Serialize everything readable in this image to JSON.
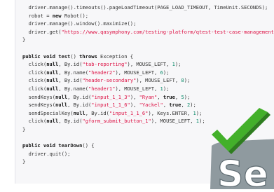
{
  "code_lines": [
    {
      "indent": 1,
      "segments": [
        {
          "t": "driver.manage().timeouts().pageLoadTimeout(PAGE_LOAD_TIMEOUT, TimeUnit.SECONDS);",
          "c": "p"
        }
      ]
    },
    {
      "indent": 1,
      "segments": [
        {
          "t": "robot = ",
          "c": "p"
        },
        {
          "t": "new",
          "c": "kw"
        },
        {
          "t": " Robot();",
          "c": "p"
        }
      ]
    },
    {
      "indent": 1,
      "segments": [
        {
          "t": "driver.manage().window().maximize();",
          "c": "p"
        }
      ]
    },
    {
      "indent": 1,
      "segments": [
        {
          "t": "driver.get(",
          "c": "p"
        },
        {
          "t": "\"https://www.qasymphony.com/testing-platform/qtest-test-case-management\"",
          "c": "str"
        },
        {
          "t": ");",
          "c": "p"
        }
      ]
    },
    {
      "indent": 0,
      "segments": [
        {
          "t": "}",
          "c": "p"
        }
      ]
    },
    {
      "indent": 0,
      "segments": [
        {
          "t": "",
          "c": "p"
        }
      ]
    },
    {
      "indent": 0,
      "segments": [
        {
          "t": "public void ",
          "c": "kw"
        },
        {
          "t": "test",
          "c": "fn"
        },
        {
          "t": "() ",
          "c": "p"
        },
        {
          "t": "throws",
          "c": "kw"
        },
        {
          "t": " Exception {",
          "c": "p"
        }
      ]
    },
    {
      "indent": 1,
      "segments": [
        {
          "t": "click(",
          "c": "p"
        },
        {
          "t": "null",
          "c": "kw"
        },
        {
          "t": ", By.id(",
          "c": "p"
        },
        {
          "t": "\"tab-reporting\"",
          "c": "str"
        },
        {
          "t": "), MOUSE_LEFT, ",
          "c": "p"
        },
        {
          "t": "1",
          "c": "num"
        },
        {
          "t": ");",
          "c": "p"
        }
      ]
    },
    {
      "indent": 1,
      "segments": [
        {
          "t": "click(",
          "c": "p"
        },
        {
          "t": "null",
          "c": "kw"
        },
        {
          "t": ", By.name(",
          "c": "p"
        },
        {
          "t": "\"header2\"",
          "c": "str"
        },
        {
          "t": "), MOUSE_LEFT, ",
          "c": "p"
        },
        {
          "t": "6",
          "c": "num"
        },
        {
          "t": ");",
          "c": "p"
        }
      ]
    },
    {
      "indent": 1,
      "segments": [
        {
          "t": "click(",
          "c": "p"
        },
        {
          "t": "null",
          "c": "kw"
        },
        {
          "t": ", By.id(",
          "c": "p"
        },
        {
          "t": "\"header-secondary\"",
          "c": "str"
        },
        {
          "t": "), MOUSE_LEFT, ",
          "c": "p"
        },
        {
          "t": "8",
          "c": "num"
        },
        {
          "t": ");",
          "c": "p"
        }
      ]
    },
    {
      "indent": 1,
      "segments": [
        {
          "t": "click(",
          "c": "p"
        },
        {
          "t": "null",
          "c": "kw"
        },
        {
          "t": ", By.name(",
          "c": "p"
        },
        {
          "t": "\"header1\"",
          "c": "str"
        },
        {
          "t": "), MOUSE_LEFT, ",
          "c": "p"
        },
        {
          "t": "1",
          "c": "num"
        },
        {
          "t": ");",
          "c": "p"
        }
      ]
    },
    {
      "indent": 1,
      "segments": [
        {
          "t": "sendKeys(",
          "c": "p"
        },
        {
          "t": "null",
          "c": "kw"
        },
        {
          "t": ", By.id(",
          "c": "p"
        },
        {
          "t": "\"input_1_1_3\"",
          "c": "str"
        },
        {
          "t": "), ",
          "c": "p"
        },
        {
          "t": "\"Ryan\"",
          "c": "str"
        },
        {
          "t": ", ",
          "c": "p"
        },
        {
          "t": "true",
          "c": "kw"
        },
        {
          "t": ", ",
          "c": "p"
        },
        {
          "t": "5",
          "c": "num"
        },
        {
          "t": ");",
          "c": "p"
        }
      ]
    },
    {
      "indent": 1,
      "segments": [
        {
          "t": "sendKeys(",
          "c": "p"
        },
        {
          "t": "null",
          "c": "kw"
        },
        {
          "t": ", By.id(",
          "c": "p"
        },
        {
          "t": "\"input_1_1_6\"",
          "c": "str"
        },
        {
          "t": "), ",
          "c": "p"
        },
        {
          "t": "\"Yackel\"",
          "c": "str"
        },
        {
          "t": ", ",
          "c": "p"
        },
        {
          "t": "true",
          "c": "kw"
        },
        {
          "t": ", ",
          "c": "p"
        },
        {
          "t": "2",
          "c": "num"
        },
        {
          "t": ");",
          "c": "p"
        }
      ]
    },
    {
      "indent": 1,
      "segments": [
        {
          "t": "sendSpecialKey(",
          "c": "p"
        },
        {
          "t": "null",
          "c": "kw"
        },
        {
          "t": ", By.id(",
          "c": "p"
        },
        {
          "t": "\"input_1_1_6\"",
          "c": "str"
        },
        {
          "t": "), Keys.ENTER, ",
          "c": "p"
        },
        {
          "t": "1",
          "c": "num"
        },
        {
          "t": ");",
          "c": "p"
        }
      ]
    },
    {
      "indent": 1,
      "segments": [
        {
          "t": "click(",
          "c": "p"
        },
        {
          "t": "null",
          "c": "kw"
        },
        {
          "t": ", By.id(",
          "c": "p"
        },
        {
          "t": "\"gform_submit_button_1\"",
          "c": "str"
        },
        {
          "t": "), MOUSE_LEFT, ",
          "c": "p"
        },
        {
          "t": "1",
          "c": "num"
        },
        {
          "t": ");",
          "c": "p"
        }
      ]
    },
    {
      "indent": 0,
      "segments": [
        {
          "t": "}",
          "c": "p"
        }
      ]
    },
    {
      "indent": 0,
      "segments": [
        {
          "t": "",
          "c": "p"
        }
      ]
    },
    {
      "indent": 0,
      "segments": [
        {
          "t": "public void ",
          "c": "kw"
        },
        {
          "t": "tearDown",
          "c": "fn"
        },
        {
          "t": "() {",
          "c": "p"
        }
      ]
    },
    {
      "indent": 1,
      "segments": [
        {
          "t": "driver.quit();",
          "c": "p"
        }
      ]
    },
    {
      "indent": 0,
      "segments": [
        {
          "t": "}",
          "c": "p"
        }
      ]
    }
  ],
  "logo": {
    "label": "Se",
    "icon": "selenium-checkmark-icon",
    "colors": {
      "green": "#43b02a",
      "dark_green": "#2e7d1f",
      "gray": "#8f9a9f",
      "text_shadow": "#5d6a70"
    }
  }
}
